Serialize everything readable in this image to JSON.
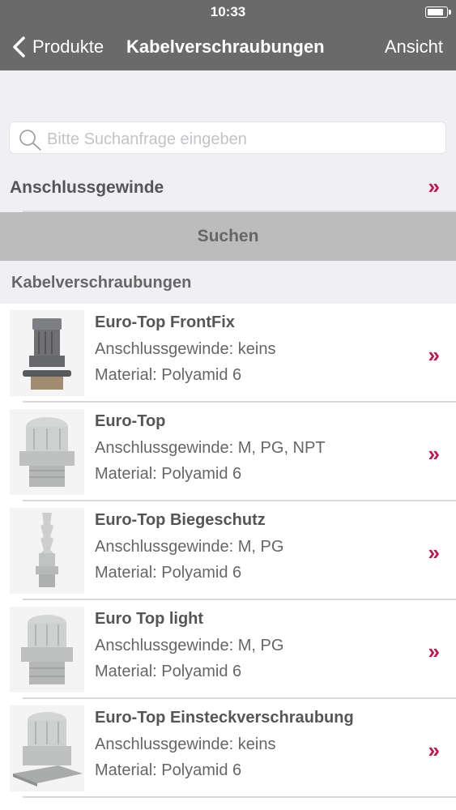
{
  "status": {
    "time": "10:33",
    "battery_level": 0.95
  },
  "nav": {
    "back_label": "Produkte",
    "title": "Kabelverschraubungen",
    "right_label": "Ansicht"
  },
  "search": {
    "placeholder": "Bitte Suchanfrage eingeben",
    "value": ""
  },
  "filter": {
    "label": "Anschlussgewinde",
    "chevron": "»"
  },
  "search_button": "Suchen",
  "section_title": "Kabelverschraubungen",
  "chevron": "»",
  "items": [
    {
      "title": "Euro-Top FrontFix",
      "thread": "Anschlussgewinde: keins",
      "material": "Material: Polyamid 6",
      "image": "cable-gland-frontfix"
    },
    {
      "title": "Euro-Top",
      "thread": "Anschlussgewinde: M, PG, NPT",
      "material": "Material: Polyamid 6",
      "image": "cable-gland"
    },
    {
      "title": "Euro-Top Biegeschutz",
      "thread": "Anschlussgewinde: M, PG",
      "material": "Material: Polyamid 6",
      "image": "cable-gland-bend-protection"
    },
    {
      "title": "Euro Top light",
      "thread": "Anschlussgewinde: M, PG",
      "material": "Material: Polyamid 6",
      "image": "cable-gland-light"
    },
    {
      "title": "Euro-Top Einsteckverschraubung",
      "thread": "Anschlussgewinde: keins",
      "material": "Material: Polyamid 6",
      "image": "cable-gland-plug-in"
    }
  ],
  "colors": {
    "nav_bg": "#6a6a6a",
    "accent": "#c0174d",
    "button_bg": "#bcbcbc"
  }
}
